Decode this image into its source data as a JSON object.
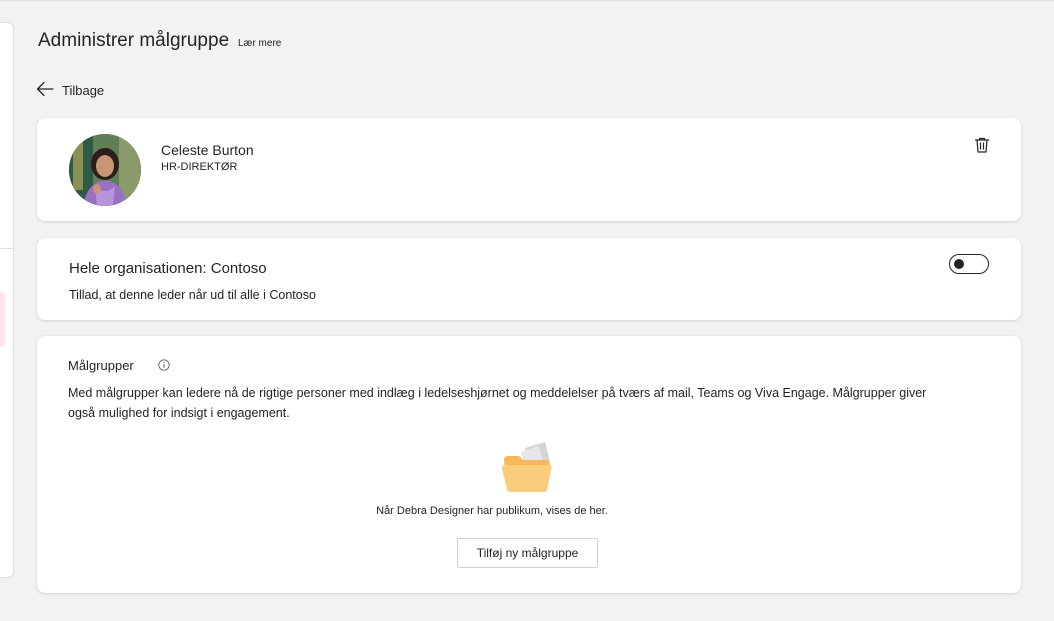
{
  "page": {
    "title": "Administrer målgruppe",
    "learn_more": "Lær mere",
    "back_label": "Tilbage"
  },
  "person": {
    "name": "Celeste Burton",
    "title": "HR-DIREKTØR",
    "avatar_icon": "person-photo",
    "delete_icon": "trash-icon"
  },
  "organization": {
    "title": "Hele organisationen: Contoso",
    "description": "Tillad, at denne leder når ud til alle i Contoso",
    "toggle_on": false
  },
  "audiences": {
    "title": "Målgrupper",
    "info_icon": "info-icon",
    "description": "Med målgrupper kan ledere nå de rigtige personer med indlæg i ledelseshjørnet og meddelelser på tværs af mail, Teams og Viva Engage. Målgrupper giver også mulighed for indsigt i engagement.",
    "empty_icon": "folder-icon",
    "empty_text": "Når Debra Designer har publikum, vises de her.",
    "add_button": "Tilføj ny målgruppe"
  },
  "colors": {
    "background": "#f3f2f1",
    "card": "#ffffff",
    "text": "#242424",
    "folder": "#f7c46c"
  }
}
